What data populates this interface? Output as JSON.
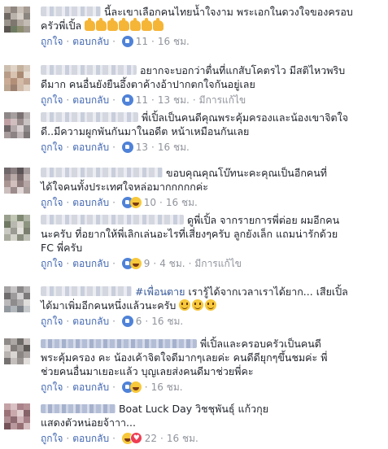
{
  "comments": [
    {
      "name": "",
      "lines": [
        "นี้ละเขาเลือกคนไทยน้ำใจงาม พระเอกในดวงใจของครอบ",
        "ครัวพี่เปิ้ล"
      ],
      "emoji": [
        "thumbs-up-emoji",
        "thumbs-up-emoji",
        "thumbs-up-emoji",
        "thumbs-up-emoji",
        "thumbs-up-emoji",
        "thumbs-up-emoji",
        "thumbs-up-emoji"
      ],
      "actions": {
        "like": "ถูกใจ",
        "reply": "ตอบกลับ",
        "count": "11",
        "time": "16 ชม.",
        "edited": ""
      }
    },
    {
      "name": "",
      "lines": [
        "อยากจะบอกว่าตื่นที่แกสับโคตรไว มีสติไหวพริบ",
        "ดีมาก คนอื่นยังยืนอึ้งตาค้างอ้าปากตกใจกันอยู่เลย"
      ],
      "actions": {
        "like": "ถูกใจ",
        "reply": "ตอบกลับ",
        "count": "11",
        "time": "13 ชม.",
        "edited": "มีการแก้ไข"
      }
    },
    {
      "name": "",
      "lines": [
        "พี่เปิ้ลเป็นคนดีคุณพระคุ้มครองและน้องเขาจิตใจ",
        "ดี..มีความผูกพันกันมาในอดีต หน้าเหมือนกันเลย"
      ],
      "actions": {
        "like": "ถูกใจ",
        "reply": "ตอบกลับ",
        "count": "13",
        "time": "16 ชม.",
        "edited": ""
      }
    },
    {
      "name": "",
      "lines": [
        "ขอบคุณคุณโบ๊ทนะคะคุณเป็นอีกคนที่",
        "ได้ใจคนทั้งประเทศใจหล่อมากกกกกค่ะ"
      ],
      "actions": {
        "like": "ถูกใจ",
        "reply": "ตอบกลับ",
        "count": "10",
        "time": "16 ชม.",
        "edited": ""
      }
    },
    {
      "name": "",
      "lines": [
        "ดูพี่เปิ้ล จากรายการพี่ต่อย ผมอีกคน",
        "นะครับ ที่อยากให้พี่เลิกเล่นอะไรที่เสี่ยงๆครับ ลูกยังเล็ก แถมน่ารักด้วย",
        "FC พี่ครับ"
      ],
      "actions": {
        "like": "ถูกใจ",
        "reply": "ตอบกลับ",
        "count": "9",
        "time": "4 ชม.",
        "edited": "มีการแก้ไข"
      }
    },
    {
      "name": "",
      "hashtag": "#เพื่อนตาย",
      "lines": [
        "เรารู้ได้จากเวลาเราได้ยาก... เสียเปิ้ล",
        "ได้มาเพิ่มอีกคนหนึ่งแล้วนะครับ"
      ],
      "emoji": [
        "smile-emoji",
        "smile-emoji",
        "smile-emoji"
      ],
      "actions": {
        "like": "ถูกใจ",
        "reply": "ตอบกลับ",
        "count": "6",
        "time": "16 ชม.",
        "edited": ""
      }
    },
    {
      "name": "",
      "lines": [
        "พี่เปิ้ลและครอบครัวเป็นคนดี",
        "พระคุ้มครอง คะ น้องเค้าจิตใจดีมากๆเลยค่ะ คนดีดียุกๆขึ้นชมค่ะ พี่",
        "ช่วยคนอื่นมาเยอะแล้ว บุญเลยส่งคนดีมาช่วยพี่คะ"
      ],
      "actions": {
        "like": "ถูกใจ",
        "reply": "ตอบกลับ",
        "count": "",
        "time": "16 ชม.",
        "edited": ""
      }
    },
    {
      "name": "",
      "lines": [
        "Boat Luck Day วิชชุพันธุ์ แก้วกุย",
        "แสดงตัวหน่อยจ้าาา..."
      ],
      "actions": {
        "like": "ถูกใจ",
        "reply": "ตอบกลับ",
        "count": "22",
        "time": "16 ชม.",
        "edited": ""
      }
    }
  ],
  "colors": {
    "link": "#4267b2",
    "name": "#365899",
    "meta": "#90949c",
    "text": "#1d2129"
  }
}
